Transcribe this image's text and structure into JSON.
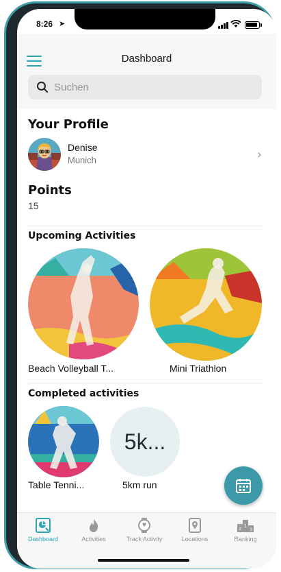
{
  "status_bar": {
    "time": "8:26"
  },
  "header": {
    "title": "Dashboard",
    "search_placeholder": "Suchen"
  },
  "profile": {
    "section_title": "Your Profile",
    "name": "Denise",
    "city": "Munich"
  },
  "points": {
    "title": "Points",
    "value": "15"
  },
  "upcoming": {
    "title": "Upcoming Activities",
    "items": [
      {
        "label": "Beach Volleyball T...",
        "image": "beach-volleyball-player"
      },
      {
        "label": "Mini Triathlon",
        "image": "triathlon-runner"
      }
    ]
  },
  "completed": {
    "title": "Completed activities",
    "items": [
      {
        "label": "Table Tenni...",
        "image": "table-tennis-player"
      },
      {
        "label": "5km run",
        "placeholder_text": "5k..."
      }
    ]
  },
  "fab": {
    "icon": "calendar-icon"
  },
  "tabbar": {
    "items": [
      {
        "label": "Dashboard",
        "icon": "dashboard-icon",
        "active": true
      },
      {
        "label": "Activities",
        "icon": "flame-icon",
        "active": false
      },
      {
        "label": "Track Activity",
        "icon": "watch-icon",
        "active": false
      },
      {
        "label": "Locations",
        "icon": "location-icon",
        "active": false
      },
      {
        "label": "Ranking",
        "icon": "ranking-icon",
        "active": false
      }
    ]
  },
  "colors": {
    "accent": "#2ba5b5",
    "fab": "#3c9aa8",
    "device_frame": "#3e9ea8"
  }
}
